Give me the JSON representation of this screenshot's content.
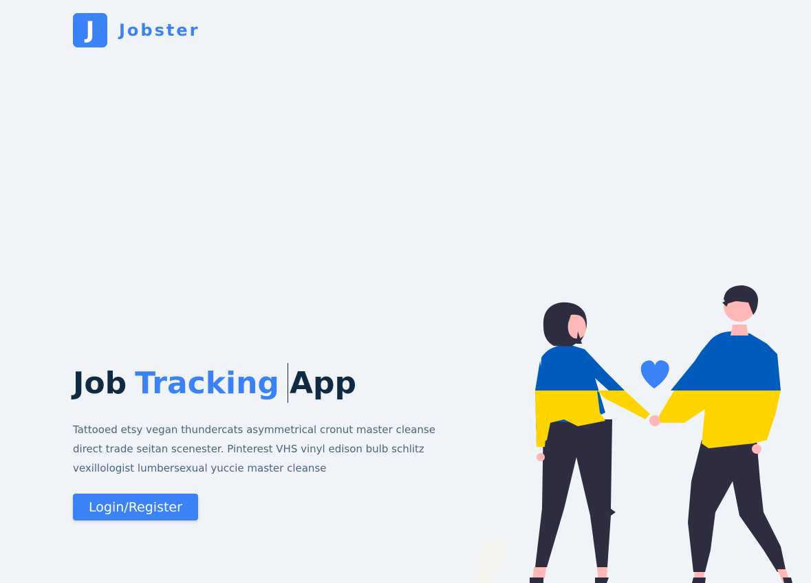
{
  "brand": {
    "logo_letter": "J",
    "name": "Jobster",
    "color": "#3b82f6"
  },
  "hero": {
    "title_part1": "Job",
    "title_accent": "Tracking",
    "title_part2": "App",
    "description": "Tattooed etsy vegan thundercats asymmetrical cronut master cleanse direct trade seitan scenester. Pinterest VHS vinyl edison bulb schlitz vexillologist lumbersexual yuccie master cleanse",
    "button_label": "Login/Register"
  },
  "illustration": {
    "icon": "couple-holding-hands-illustration",
    "colors": {
      "blue": "#005bbb",
      "yellow": "#ffd500",
      "heart": "#3b82f6"
    }
  }
}
